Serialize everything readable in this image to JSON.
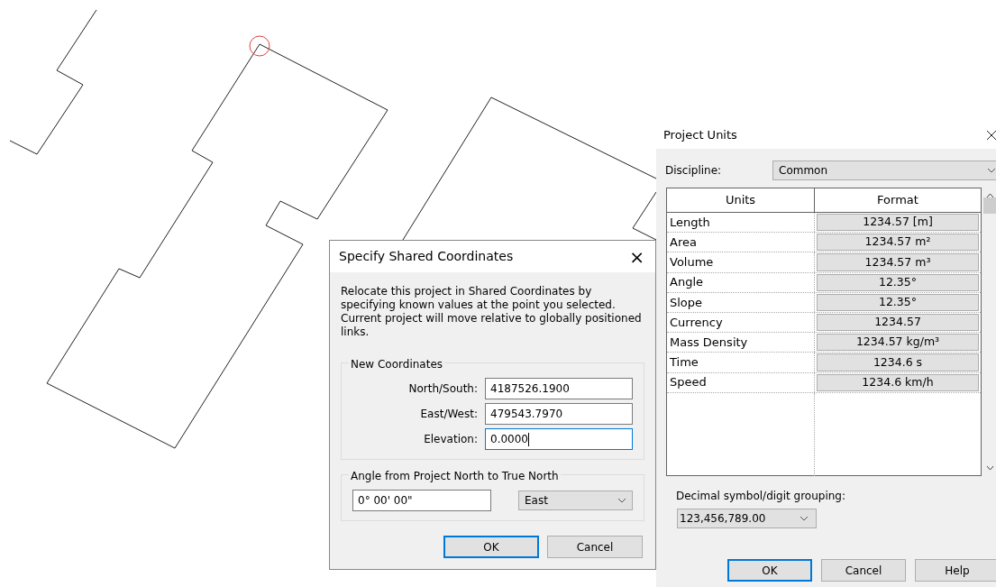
{
  "shared_coordinates_dialog": {
    "title": "Specify Shared Coordinates",
    "close": "×",
    "description": "Relocate this project in Shared Coordinates by specifying known values at the point you selected. Current project will move relative to globally positioned links.",
    "new_coordinates": {
      "title": "New Coordinates",
      "fields": [
        {
          "label": "North/South:",
          "value": "4187526.1900",
          "focused": false
        },
        {
          "label": "East/West:",
          "value": "479543.7970",
          "focused": false
        },
        {
          "label": "Elevation:",
          "value": "0.0000",
          "focused": true
        }
      ]
    },
    "angle": {
      "title": "Angle from Project North to True North",
      "value": "0° 00' 00\"",
      "direction": "East"
    },
    "buttons": [
      {
        "label": "OK",
        "default": true
      },
      {
        "label": "Cancel",
        "default": false
      }
    ]
  },
  "project_units_dialog": {
    "title": "Project Units",
    "discipline": {
      "label": "Discipline:",
      "value": "Common"
    },
    "table": {
      "columns": [
        "Units",
        "Format"
      ],
      "rows": [
        {
          "unit": "Length",
          "format": "1234.57 [m]"
        },
        {
          "unit": "Area",
          "format": "1234.57 m²"
        },
        {
          "unit": "Volume",
          "format": "1234.57 m³"
        },
        {
          "unit": "Angle",
          "format": "12.35°"
        },
        {
          "unit": "Slope",
          "format": "12.35°"
        },
        {
          "unit": "Currency",
          "format": "1234.57"
        },
        {
          "unit": "Mass Density",
          "format": "1234.57 kg/m³"
        },
        {
          "unit": "Time",
          "format": "1234.6 s"
        },
        {
          "unit": "Speed",
          "format": "1234.6 km/h"
        }
      ]
    },
    "decimal": {
      "label": "Decimal symbol/digit grouping:",
      "value": "123,456,789.00"
    },
    "buttons": [
      {
        "label": "OK",
        "default": true
      },
      {
        "label": "Cancel",
        "default": false
      },
      {
        "label": "Help",
        "default": false
      }
    ]
  }
}
